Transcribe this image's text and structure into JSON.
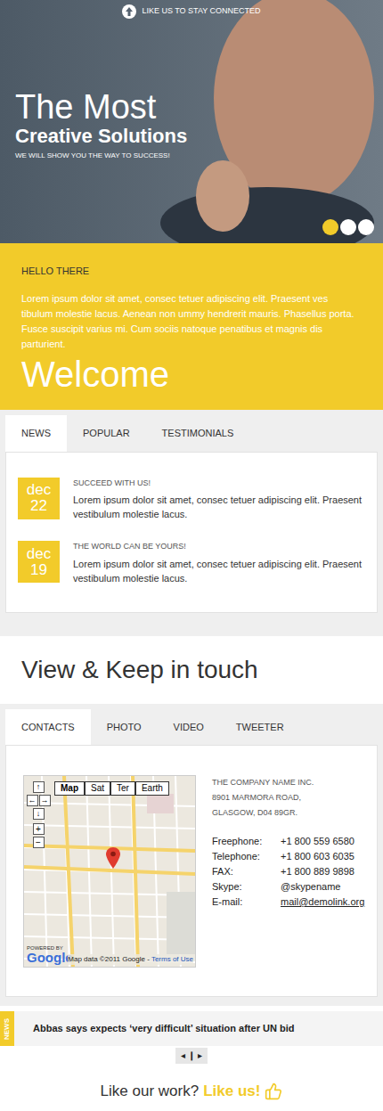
{
  "topbar": {
    "label": "LIKE US TO STAY CONNECTED"
  },
  "hero": {
    "title": "The Most",
    "subtitle": "Creative Solutions",
    "tagline": "WE WILL SHOW YOU THE WAY TO SUCCESS!",
    "dots": [
      {
        "selected": true
      },
      {
        "selected": false
      },
      {
        "selected": false
      }
    ]
  },
  "intro": {
    "heading": "HELLO THERE",
    "text": "Lorem ipsum dolor sit amet, consec tetuer adipiscing elit. Praesent ves tibulum molestie lacus. Aenean non ummy hendrerit mauris. Phasellus porta. Fusce suscipit varius mi. Cum sociis natoque penatibus et magnis dis parturient.",
    "welcome": "Welcome"
  },
  "news_tabs": [
    {
      "label": "NEWS",
      "selected": true
    },
    {
      "label": "POPULAR",
      "selected": false
    },
    {
      "label": "TESTIMONIALS",
      "selected": false
    }
  ],
  "news": [
    {
      "month": "dec",
      "day": "22",
      "title": "SUCCEED WITH US!",
      "text": "Lorem ipsum dolor sit amet, consec tetuer adipiscing elit. Praesent vestibulum molestie lacus."
    },
    {
      "month": "dec",
      "day": "19",
      "title": "THE WORLD CAN BE YOURS!",
      "text": "Lorem ipsum dolor sit amet, consec tetuer adipiscing elit. Praesent vestibulum molestie lacus."
    }
  ],
  "section_title": "View & Keep in touch",
  "contact_tabs": [
    {
      "label": "CONTACTS",
      "selected": true
    },
    {
      "label": "PHOTO",
      "selected": false
    },
    {
      "label": "VIDEO",
      "selected": false
    },
    {
      "label": "TWEETER",
      "selected": false
    }
  ],
  "map": {
    "types": [
      {
        "label": "Map",
        "selected": true
      },
      {
        "label": "Sat",
        "selected": false
      },
      {
        "label": "Ter",
        "selected": false
      },
      {
        "label": "Earth",
        "selected": false
      }
    ],
    "pan": [
      "↑",
      "←",
      "→",
      "↓"
    ],
    "zoom": [
      "+",
      "−"
    ],
    "powered_by": "POWERED BY",
    "logo": "Google",
    "attribution": "Map data ©2011 Google -",
    "terms": "Terms of Use"
  },
  "company": {
    "name": "THE COMPANY NAME INC.",
    "address": [
      "8901 MARMORA ROAD,",
      "GLASGOW, D04 89GR."
    ]
  },
  "contacts": [
    {
      "label": "Freephone:",
      "value": "+1 800 559 6580",
      "kind": "text"
    },
    {
      "label": "Telephone:",
      "value": "+1 800 603 6035",
      "kind": "text"
    },
    {
      "label": "FAX:",
      "value": "+1 800 889 9898",
      "kind": "text"
    },
    {
      "label": "Skype:",
      "value": "@skypename",
      "kind": "text"
    },
    {
      "label": "E-mail:",
      "value": "mail@demolink.org",
      "kind": "link"
    }
  ],
  "ticker": {
    "label": "NEWS",
    "headline": "Abbas says expects ‘very difficult’ situation after UN bid",
    "controls": [
      "◂",
      "❙",
      "▸"
    ]
  },
  "footer": {
    "question": "Like our work?",
    "cta": "Like us!"
  }
}
